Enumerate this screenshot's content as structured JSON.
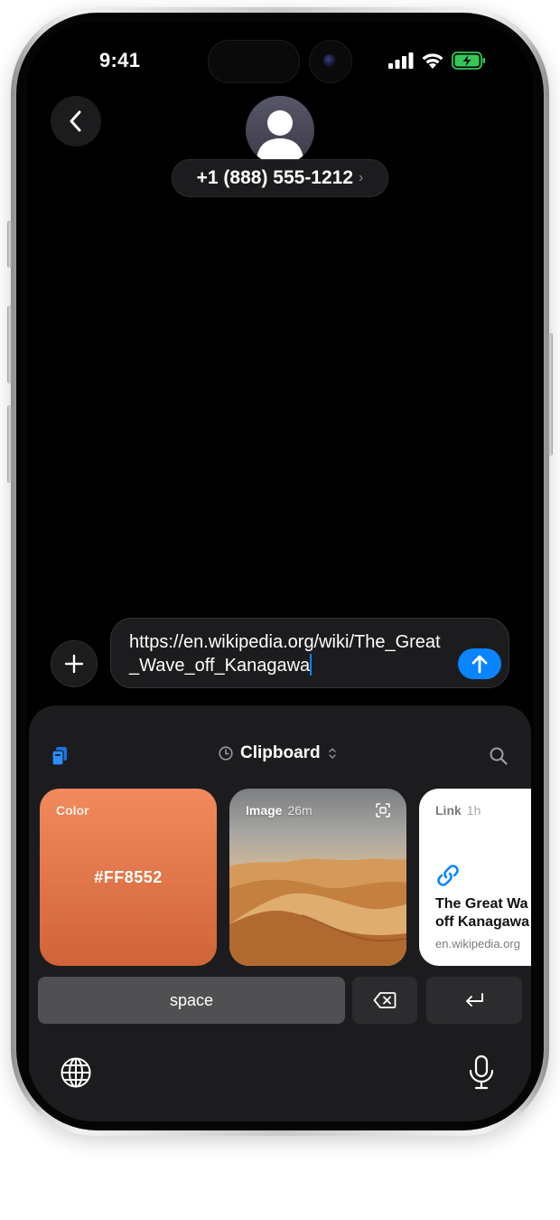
{
  "status_bar": {
    "time": "9:41"
  },
  "header": {
    "contact": "+1 (888) 555-1212",
    "chevron": "›"
  },
  "compose": {
    "text": "https://en.wikipedia.org/wiki/The_Great_Wave_off_Kanagawa"
  },
  "clipboard": {
    "title": "Clipboard",
    "cards": [
      {
        "kind": "Color",
        "time": "",
        "value": "#FF8552"
      },
      {
        "kind": "Image",
        "time": "26m"
      },
      {
        "kind": "Link",
        "time": "1h",
        "title_line1": "The Great Wa",
        "title_line2": "off Kanagawa",
        "domain": "en.wikipedia.org"
      }
    ]
  },
  "keyboard": {
    "space_label": "space"
  },
  "icons": [
    "back-chevron-icon",
    "person-icon",
    "signal-icon",
    "wifi-icon",
    "battery-icon",
    "plus-icon",
    "send-arrow-icon",
    "clipboard-app-icon",
    "clock-icon",
    "sort-chevrons-icon",
    "search-icon",
    "scan-icon",
    "link-icon",
    "delete-icon",
    "return-icon",
    "globe-icon",
    "microphone-icon"
  ],
  "colors": {
    "accent": "#0a84ff",
    "battery": "#34c759",
    "color_card": "#FF8552"
  }
}
